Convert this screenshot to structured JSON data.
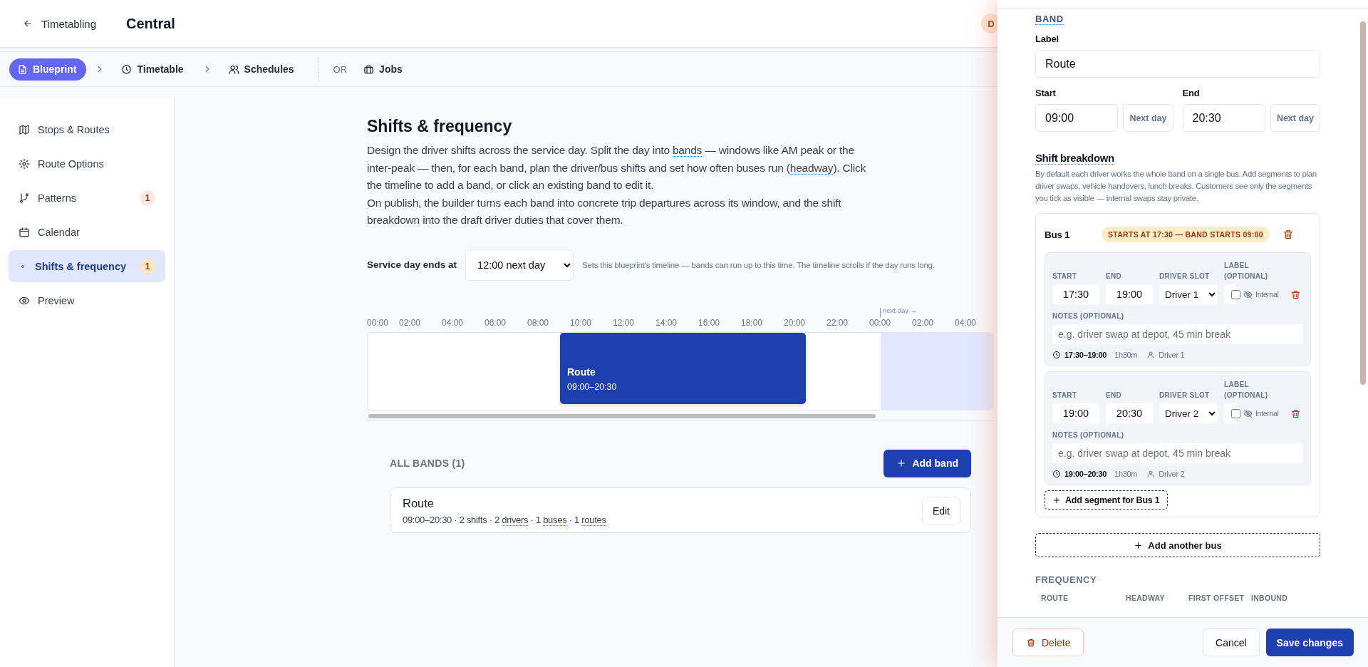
{
  "header": {
    "back_link": "Timetabling",
    "title": "Central",
    "avatar": "D"
  },
  "steps": [
    {
      "label": "Blueprint",
      "selected": true
    },
    {
      "label": "Timetable",
      "selected": false
    },
    {
      "label": "Schedules",
      "selected": false
    }
  ],
  "or_label": "OR",
  "jobs": {
    "label": "Jobs",
    "selected": false
  },
  "sidebar": {
    "items": [
      {
        "label": "Stops & Routes",
        "selected": false
      },
      {
        "label": "Route Options",
        "selected": false
      },
      {
        "label": "Patterns",
        "selected": false,
        "badge": "1"
      },
      {
        "label": "Calendar",
        "selected": false
      },
      {
        "label": "Shifts & frequency",
        "selected": true,
        "badge": "1"
      },
      {
        "label": "Preview",
        "selected": false
      }
    ]
  },
  "page": {
    "title": "Shifts & frequency",
    "paragraphs": [
      [
        {
          "text": "Design the driver shifts across the service day. Split the day into ",
          "term": false
        },
        {
          "text": "bands",
          "term": true
        },
        {
          "text": " — windows like AM peak or the inter-peak — then, for each band, plan the driver/bus shifts and set how often buses run (",
          "term": false
        },
        {
          "text": "headway",
          "term": true
        },
        {
          "text": "). Click the timeline to add a band, or click an existing band to edit it.",
          "term": false
        }
      ],
      [
        {
          "text": "On publish, the builder turns each band into concrete trip departures across its window, and the shift breakdown into the draft driver duties that cover them.",
          "term": false
        }
      ]
    ],
    "service_day": {
      "label": "Service day ends at",
      "value": "12:00 next day",
      "hint": "Sets this blueprint's timeline — bands can run up to this time. The timeline scrolls if the day runs long."
    }
  },
  "timeline": {
    "hours": [
      "00:00",
      "02:00",
      "04:00",
      "06:00",
      "08:00",
      "10:00",
      "12:00",
      "14:00",
      "16:00",
      "18:00",
      "20:00",
      "22:00",
      "00:00",
      "02:00",
      "04:00"
    ],
    "next_day_label": "next day →",
    "bands": [
      {
        "label": "Route",
        "time": "09:00–20:30"
      }
    ]
  },
  "bands_list": {
    "heading": "ALL BANDS (1)",
    "add_button": "Add band",
    "items": [
      {
        "name": "Route",
        "summary": [
          {
            "text": "09:00–20:30 · 2 shifts · 2 ",
            "term": false
          },
          {
            "text": "drivers",
            "term": true
          },
          {
            "text": " · 1 ",
            "term": false
          },
          {
            "text": "buses",
            "term": true
          },
          {
            "text": " · 1 ",
            "term": false
          },
          {
            "text": "routes",
            "term": true
          }
        ],
        "edit_button": "Edit"
      }
    ]
  },
  "drawer": {
    "section": "BAND",
    "label_field": {
      "label": "Label",
      "value": "Route"
    },
    "start": {
      "label": "Start",
      "value": "09:00",
      "next_day": "Next day"
    },
    "end": {
      "label": "End",
      "value": "20:30",
      "next_day": "Next day"
    },
    "shift_breakdown": {
      "title": "Shift breakdown",
      "description": "By default each driver works the whole band on a single bus. Add segments to plan driver swaps, vehicle handovers, lunch breaks. Customers see only the segments you tick as visible — internal swaps stay private.",
      "buses": [
        {
          "name": "Bus 1",
          "warning": "STARTS AT 17:30 — BAND STARTS 09:00",
          "segments": [
            {
              "start_label": "START",
              "start": "17:30",
              "end_label": "END",
              "end": "19:00",
              "driver_label": "DRIVER SLOT",
              "driver": "Driver 1",
              "label_label": "LABEL (OPTIONAL)",
              "internal": false,
              "internal_label": "Internal",
              "notes_label": "NOTES (OPTIONAL)",
              "notes_placeholder": "e.g. driver swap at depot, 45 min break",
              "span": "17:30–19:00",
              "duration": "1h30m",
              "driver_name": "Driver 1"
            },
            {
              "start_label": "START",
              "start": "19:00",
              "end_label": "END",
              "end": "20:30",
              "driver_label": "DRIVER SLOT",
              "driver": "Driver 2",
              "label_label": "LABEL (OPTIONAL)",
              "internal": false,
              "internal_label": "Internal",
              "notes_label": "NOTES (OPTIONAL)",
              "notes_placeholder": "e.g. driver swap at depot, 45 min break",
              "span": "19:00–20:30",
              "duration": "1h30m",
              "driver_name": "Driver 2"
            }
          ],
          "add_segment": "Add segment for Bus 1"
        }
      ],
      "add_bus": "Add another bus"
    },
    "frequency": {
      "title": "FREQUENCY",
      "columns": [
        "ROUTE",
        "HEADWAY",
        "FIRST OFFSET",
        "INBOUND"
      ]
    },
    "footer": {
      "delete": "Delete",
      "cancel": "Cancel",
      "save": "Save changes"
    }
  }
}
